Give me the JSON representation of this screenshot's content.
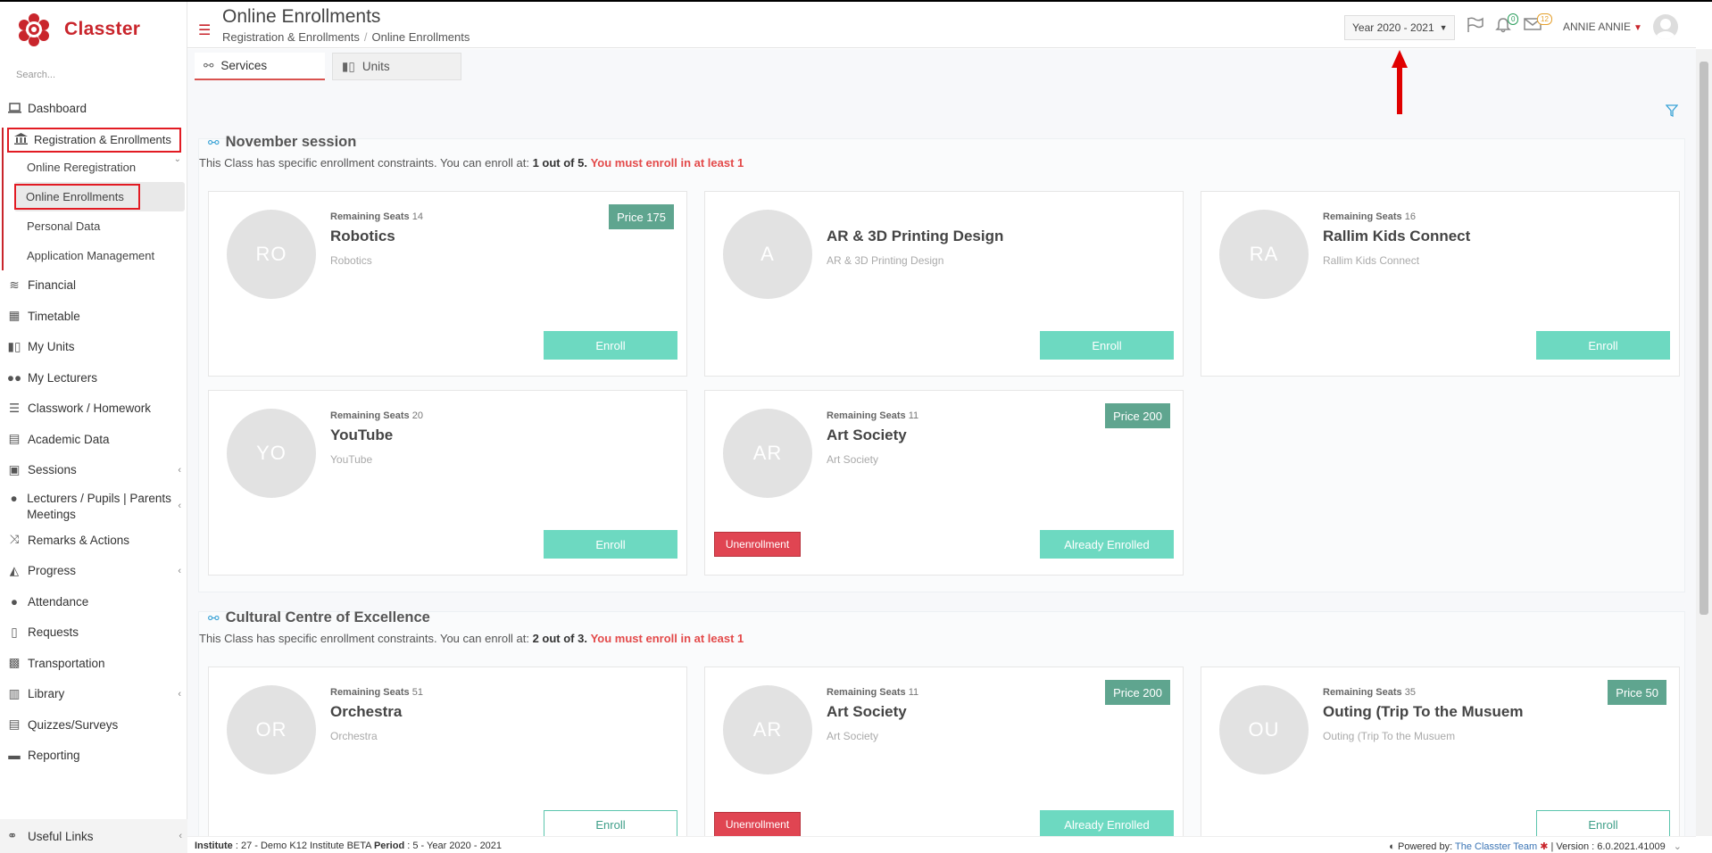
{
  "app": {
    "name": "Classter"
  },
  "sidebar": {
    "search_placeholder": "Search...",
    "items_top": [
      {
        "label": "Dashboard",
        "icon": "laptop-icon"
      }
    ],
    "registration": {
      "label": "Registration & Enrollments",
      "subitems": [
        "Online Reregistration",
        "Online Enrollments",
        "Personal Data",
        "Application Management"
      ],
      "active": "Online Enrollments"
    },
    "items": [
      {
        "label": "Financial"
      },
      {
        "label": "Timetable"
      },
      {
        "label": "My Units"
      },
      {
        "label": "My Lecturers"
      },
      {
        "label": "Classwork / Homework"
      },
      {
        "label": "Academic Data"
      },
      {
        "label": "Sessions"
      },
      {
        "label": "Lecturers / Pupils | Parents Meetings"
      },
      {
        "label": "Remarks & Actions"
      },
      {
        "label": "Progress"
      },
      {
        "label": "Attendance"
      },
      {
        "label": "Requests"
      },
      {
        "label": "Transportation"
      },
      {
        "label": "Library"
      },
      {
        "label": "Quizzes/Surveys"
      },
      {
        "label": "Reporting"
      }
    ],
    "useful_links": "Useful Links"
  },
  "header": {
    "title": "Online Enrollments",
    "breadcrumb": [
      "Registration & Enrollments",
      "Online Enrollments"
    ],
    "year": "Year 2020 - 2021",
    "notifications_count": "0",
    "messages_count": "12",
    "user": "ANNIE ANNIE"
  },
  "tabs": [
    "Services",
    "Units"
  ],
  "sessions": [
    {
      "title": "November session",
      "constraint_prefix": "This Class has specific enrollment constraints. You can enroll at: ",
      "constraint_value": "1 out of 5.",
      "constraint_must": "You must enroll in at least 1",
      "cards": [
        {
          "initials": "RO",
          "seats_label": "Remaining Seats",
          "seats": "14",
          "name": "Robotics",
          "sub": "Robotics",
          "price": "Price 175",
          "action": "Enroll"
        },
        {
          "initials": "A",
          "seats_label": "",
          "seats": "",
          "name": "AR & 3D Printing Design",
          "sub": "AR & 3D Printing Design",
          "price": "",
          "action": "Enroll"
        },
        {
          "initials": "RA",
          "seats_label": "Remaining Seats",
          "seats": "16",
          "name": "Rallim Kids Connect",
          "sub": "Rallim Kids Connect",
          "price": "",
          "action": "Enroll"
        },
        {
          "initials": "YO",
          "seats_label": "Remaining Seats",
          "seats": "20",
          "name": "YouTube",
          "sub": "YouTube",
          "price": "",
          "action": "Enroll"
        },
        {
          "initials": "AR",
          "seats_label": "Remaining Seats",
          "seats": "11",
          "name": "Art Society",
          "sub": "Art Society",
          "price": "Price 200",
          "action": "Already Enrolled",
          "unenroll": "Unenrollment"
        }
      ]
    },
    {
      "title": "Cultural Centre of Excellence",
      "constraint_prefix": "This Class has specific enrollment constraints. You can enroll at: ",
      "constraint_value": "2 out of 3.",
      "constraint_must": "You must enroll in at least 1",
      "cards": [
        {
          "initials": "OR",
          "seats_label": "Remaining Seats",
          "seats": "51",
          "name": "Orchestra",
          "sub": "Orchestra",
          "price": "",
          "action": "Enroll"
        },
        {
          "initials": "AR",
          "seats_label": "Remaining Seats",
          "seats": "11",
          "name": "Art Society",
          "sub": "Art Society",
          "price": "Price 200",
          "action": "Already Enrolled",
          "unenroll": "Unenrollment"
        },
        {
          "initials": "OU",
          "seats_label": "Remaining Seats",
          "seats": "35",
          "name": "Outing (Trip To the Musuem",
          "sub": "Outing (Trip To the Musuem",
          "price": "Price 50",
          "action": "Enroll"
        }
      ]
    }
  ],
  "footer": {
    "institute_label": "Institute",
    "institute": " : 27 - Demo K12 Institute BETA ",
    "period_label": "Period",
    "period": " : 5 - Year 2020 - 2021",
    "powered_by": "Powered by: ",
    "team": "The Classter Team",
    "version": " | Version : 6.0.2021.41009"
  },
  "colors": {
    "brand": "#c9252c",
    "enroll": "#6dd9c1",
    "price": "#5fa58f",
    "danger": "#e04552"
  }
}
